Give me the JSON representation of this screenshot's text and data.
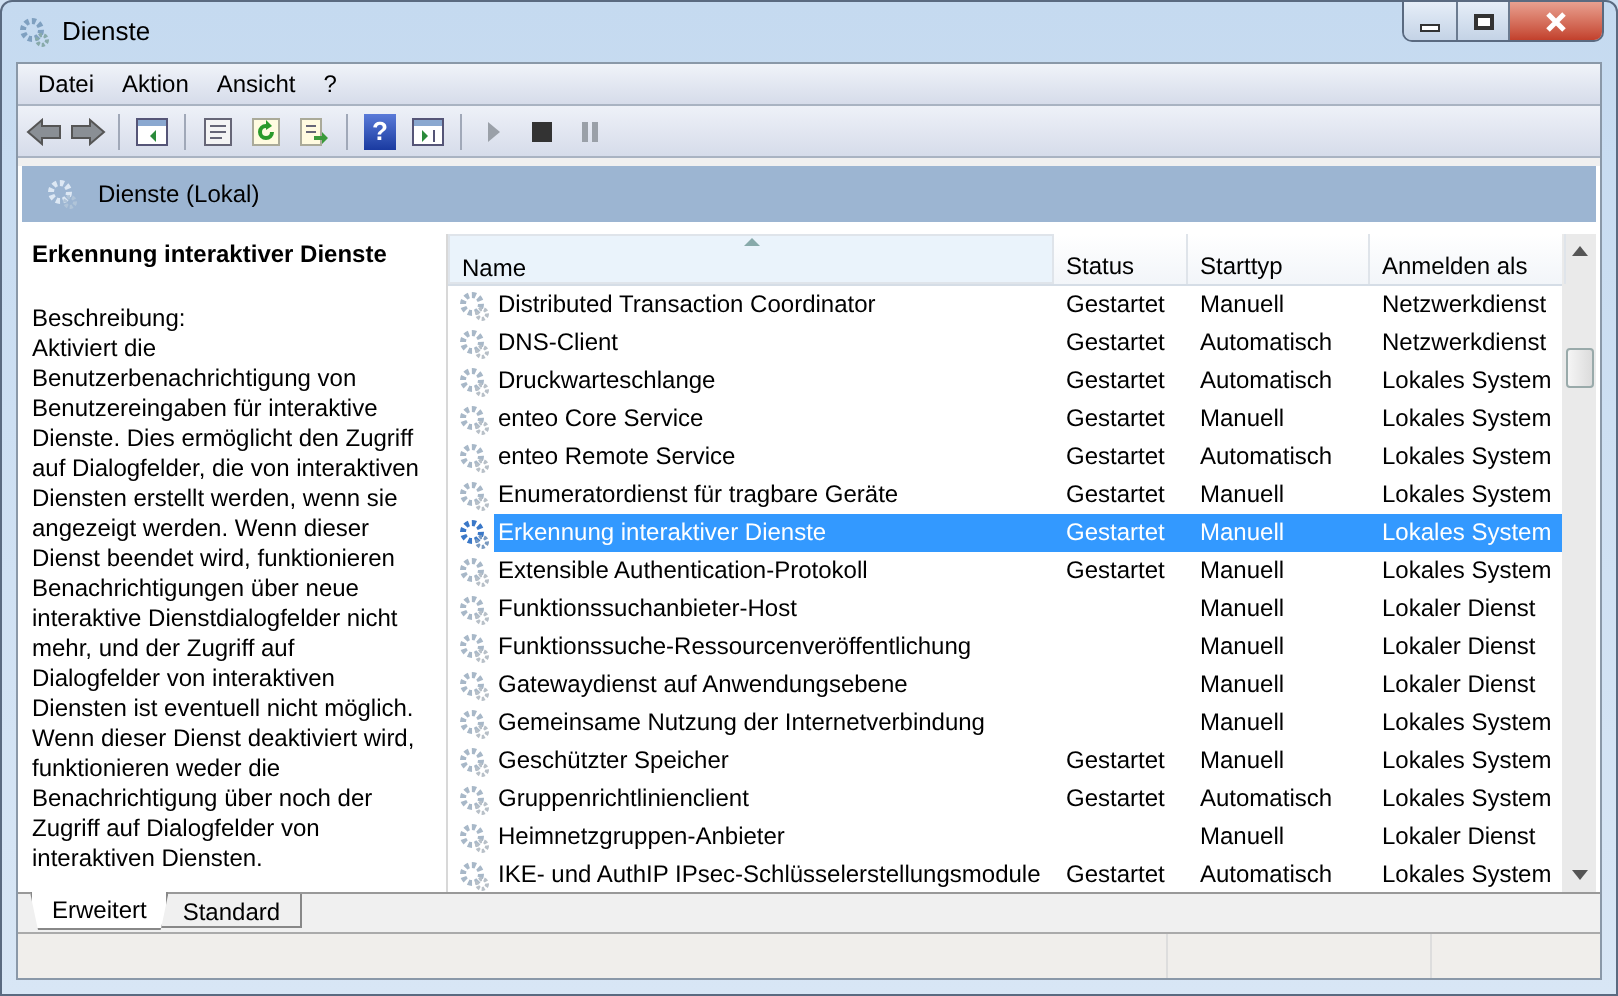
{
  "window": {
    "title": "Dienste"
  },
  "menu": [
    {
      "label": "Datei"
    },
    {
      "label": "Aktion"
    },
    {
      "label": "Ansicht"
    },
    {
      "label": "?"
    }
  ],
  "toolbar": {
    "help_icon": "?"
  },
  "header": {
    "title": "Dienste (Lokal)"
  },
  "details": {
    "title": "Erkennung interaktiver Dienste",
    "label": "Beschreibung:",
    "description": "Aktiviert die Benutzerbenachrichtigung von Benutzereingaben für interaktive Dienste. Dies ermöglicht den Zugriff auf Dialogfelder, die von interaktiven Diensten erstellt werden, wenn sie angezeigt werden. Wenn dieser Dienst beendet wird, funktionieren Benachrichtigungen über neue interaktive Dienstdialogfelder nicht mehr, und der Zugriff auf Dialogfelder von interaktiven Diensten ist eventuell nicht möglich. Wenn dieser Dienst deaktiviert wird, funktionieren weder die Benachrichtigung über noch der Zugriff auf Dialogfelder von interaktiven Diensten."
  },
  "table": {
    "columns": [
      "Name",
      "Status",
      "Starttyp",
      "Anmelden als"
    ],
    "rows": [
      {
        "name": "Distributed Transaction Coordinator",
        "status": "Gestartet",
        "starttyp": "Manuell",
        "anmelden_als": "Netzwerkdienst",
        "selected": false
      },
      {
        "name": "DNS-Client",
        "status": "Gestartet",
        "starttyp": "Automatisch",
        "anmelden_als": "Netzwerkdienst",
        "selected": false
      },
      {
        "name": "Druckwarteschlange",
        "status": "Gestartet",
        "starttyp": "Automatisch",
        "anmelden_als": "Lokales System",
        "selected": false
      },
      {
        "name": "enteo Core Service",
        "status": "Gestartet",
        "starttyp": "Manuell",
        "anmelden_als": "Lokales System",
        "selected": false
      },
      {
        "name": "enteo Remote Service",
        "status": "Gestartet",
        "starttyp": "Automatisch",
        "anmelden_als": "Lokales System",
        "selected": false
      },
      {
        "name": "Enumeratordienst für tragbare Geräte",
        "status": "Gestartet",
        "starttyp": "Manuell",
        "anmelden_als": "Lokales System",
        "selected": false
      },
      {
        "name": "Erkennung interaktiver Dienste",
        "status": "Gestartet",
        "starttyp": "Manuell",
        "anmelden_als": "Lokales System",
        "selected": true
      },
      {
        "name": "Extensible Authentication-Protokoll",
        "status": "Gestartet",
        "starttyp": "Manuell",
        "anmelden_als": "Lokales System",
        "selected": false
      },
      {
        "name": "Funktionssuchanbieter-Host",
        "starttyp": "Manuell",
        "anmelden_als": "Lokaler Dienst",
        "selected": false
      },
      {
        "name": "Funktionssuche-Ressourcenveröffentlichung",
        "starttyp": "Manuell",
        "anmelden_als": "Lokaler Dienst",
        "selected": false
      },
      {
        "name": "Gatewaydienst auf Anwendungsebene",
        "starttyp": "Manuell",
        "anmelden_als": "Lokaler Dienst",
        "selected": false
      },
      {
        "name": "Gemeinsame Nutzung der Internetverbindung",
        "starttyp": "Manuell",
        "anmelden_als": "Lokales System",
        "selected": false
      },
      {
        "name": "Geschützter Speicher",
        "status": "Gestartet",
        "starttyp": "Manuell",
        "anmelden_als": "Lokales System",
        "selected": false
      },
      {
        "name": "Gruppenrichtlinienclient",
        "status": "Gestartet",
        "starttyp": "Automatisch",
        "anmelden_als": "Lokales System",
        "selected": false
      },
      {
        "name": "Heimnetzgruppen-Anbieter",
        "starttyp": "Manuell",
        "anmelden_als": "Lokaler Dienst",
        "selected": false
      },
      {
        "name": "IKE- und AuthIP IPsec-Schlüsselerstellungsmodule",
        "status": "Gestartet",
        "starttyp": "Automatisch",
        "anmelden_als": "Lokales System",
        "selected": false
      }
    ]
  },
  "tabs": [
    {
      "label": "Erweitert",
      "selected": true
    },
    {
      "label": "Standard",
      "selected": false
    }
  ]
}
